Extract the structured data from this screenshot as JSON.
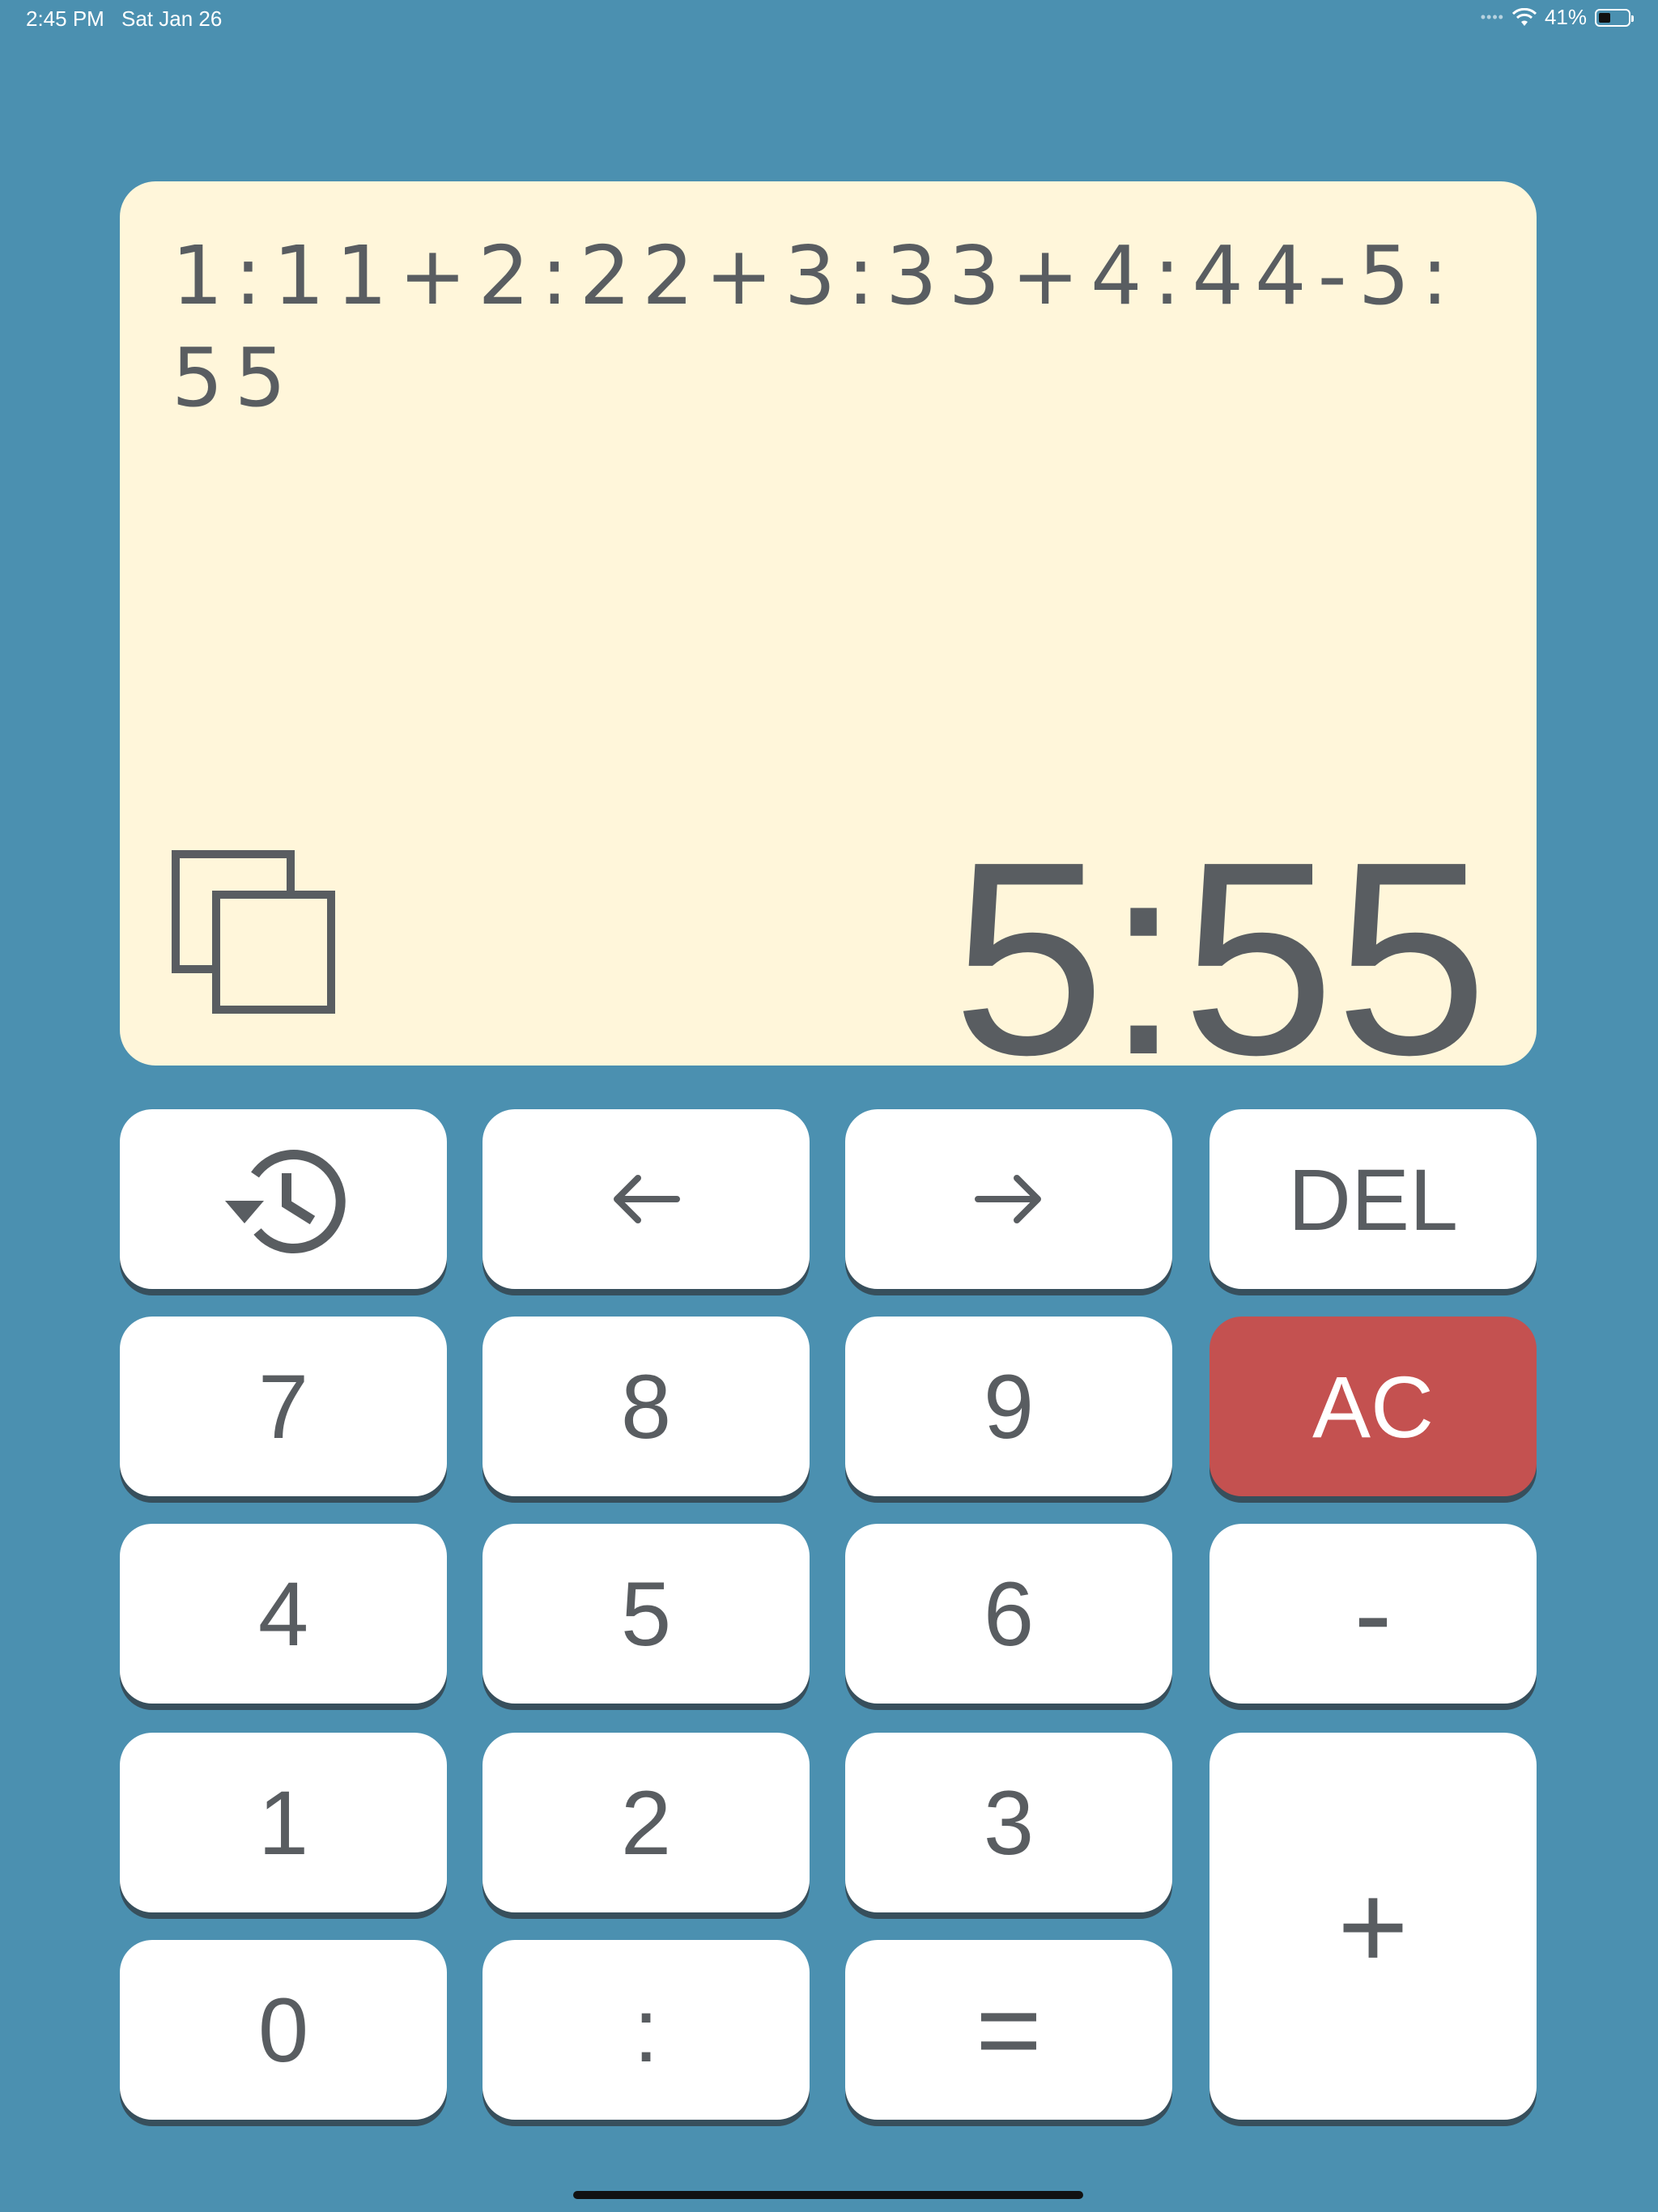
{
  "status_bar": {
    "time": "2:45 PM",
    "date": "Sat Jan 26",
    "battery": "41%",
    "battery_level": 0.41,
    "icons": [
      "cellular-dots",
      "wifi",
      "battery"
    ]
  },
  "display": {
    "expression": "1:11+2:22+3:33+4:44-5:55",
    "result": "5:55",
    "background_color": "#fff6da",
    "copy_icon": "copy"
  },
  "keypad": {
    "history_icon": "history",
    "left_icon": "arrow-left",
    "right_icon": "arrow-right",
    "del": "DEL",
    "seven": "7",
    "eight": "8",
    "nine": "9",
    "ac": "AC",
    "four": "4",
    "five": "5",
    "six": "6",
    "minus": "-",
    "one": "1",
    "two": "2",
    "three": "3",
    "plus": "+",
    "zero": "0",
    "colon": ":",
    "equals": "=",
    "key_color": "#ffffff",
    "ac_color": "#c45150",
    "background_color": "#4b90b0"
  }
}
